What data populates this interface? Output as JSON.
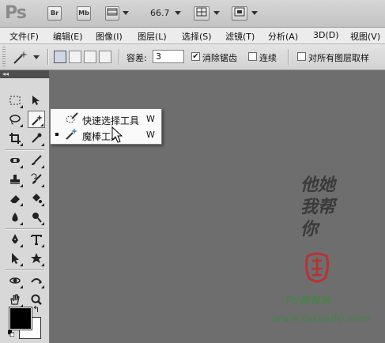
{
  "app": {
    "logo": "Ps",
    "bridge_label": "Br",
    "minibridge_label": "Mb",
    "zoom": "66.7"
  },
  "menu": [
    "文件(F)",
    "编辑(E)",
    "图像(I)",
    "图层(L)",
    "选择(S)",
    "滤镜(T)",
    "分析(A)",
    "3D(D)",
    "视图(V)"
  ],
  "options": {
    "tolerance_label": "容差:",
    "tolerance_value": "3",
    "antialias_label": "消除锯齿",
    "antialias_checked": true,
    "contiguous_label": "连续",
    "contiguous_checked": false,
    "sample_all_label": "对所有图层取样",
    "sample_all_checked": false
  },
  "toolbox": {
    "collapse_label": "◂◂"
  },
  "popup": {
    "items": [
      {
        "name": "快速选择工具",
        "shortcut": "W",
        "selected": false,
        "icon": "quick-selection-icon"
      },
      {
        "name": "魔棒工具",
        "shortcut": "W",
        "selected": true,
        "icon": "magic-wand-icon"
      }
    ]
  },
  "colors": {
    "foreground": "#000000",
    "background": "#ffffff",
    "watermark": "#3b8a3b",
    "seal": "#b83232"
  },
  "watermark": {
    "signature": "他她 我帮 你",
    "site_title": "PS教程网",
    "url": "www.tata580.com"
  }
}
